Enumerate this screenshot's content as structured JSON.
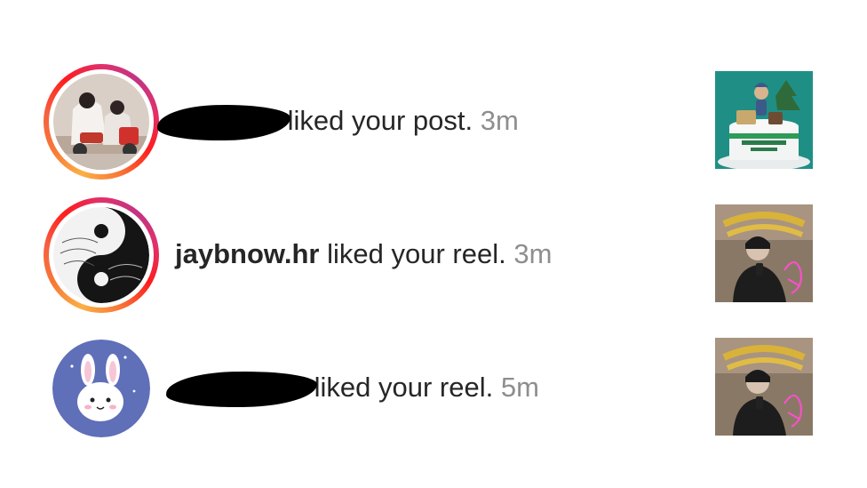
{
  "notifications": [
    {
      "username": "",
      "username_redacted": true,
      "action": "liked your post.",
      "time": "3m",
      "avatar_icon": "photo-avatar-icon",
      "has_story_ring": true,
      "thumbnail_icon": "birthday-cake-thumbnail"
    },
    {
      "username": "jaybnow.hr",
      "username_redacted": false,
      "action": "liked your reel.",
      "time": "3m",
      "avatar_icon": "yin-yang-avatar-icon",
      "has_story_ring": true,
      "thumbnail_icon": "happy-birthday-reel-thumbnail"
    },
    {
      "username": "",
      "username_redacted": true,
      "action": "liked your reel.",
      "time": "5m",
      "avatar_icon": "bunny-avatar-icon",
      "has_story_ring": false,
      "thumbnail_icon": "happy-birthday-reel-thumbnail"
    }
  ],
  "colors": {
    "text": "#262626",
    "timestamp": "#8e8e8e",
    "story_ring_start": "#fcaf45",
    "story_ring_end": "#e1306c",
    "bunny_avatar_bg": "#5f6fb8",
    "cake_thumbnail_bg": "#1f8f86"
  }
}
